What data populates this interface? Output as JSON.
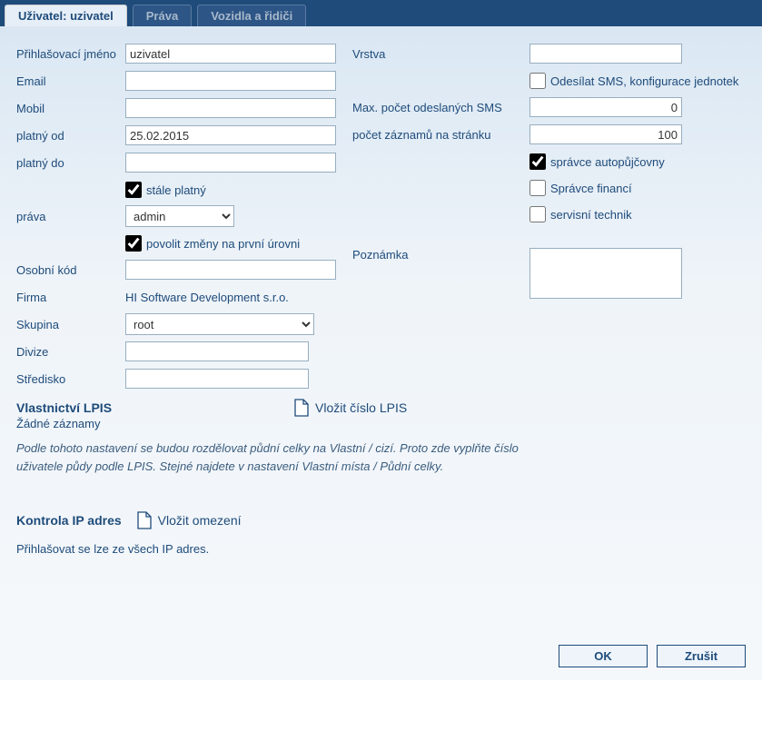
{
  "tabs": {
    "user": "Uživatel:  uzivatel",
    "rights": "Práva",
    "vehicles": "Vozidla a řidiči"
  },
  "left": {
    "login_label": "Přihlašovací jméno",
    "login_value": "uzivatel",
    "email_label": "Email",
    "email_value": "",
    "mobile_label": "Mobil",
    "mobile_value": "",
    "valid_from_label": "platný od",
    "valid_from_value": "25.02.2015",
    "valid_to_label": "platný do",
    "valid_to_value": "",
    "always_valid_label": "stále platný",
    "rights_label": "práva",
    "rights_value": "admin",
    "allow_changes_label": "povolit změny na první úrovni",
    "personal_code_label": "Osobní kód",
    "personal_code_value": "",
    "company_label": "Firma",
    "company_value": "HI Software Development s.r.o.",
    "group_label": "Skupina",
    "group_value": "root",
    "division_label": "Divize",
    "division_value": "",
    "center_label": "Středisko",
    "center_value": ""
  },
  "right": {
    "layer_label": "Vrstva",
    "layer_value": "",
    "send_sms_label": "Odesílat SMS, konfigurace jednotek",
    "max_sms_label": "Max. počet odeslaných SMS",
    "max_sms_value": "0",
    "records_label": "počet záznamů na stránku",
    "records_value": "100",
    "rental_admin_label": "správce autopůjčovny",
    "finance_admin_label": "Správce financí",
    "service_tech_label": "servisní technik",
    "note_label": "Poznámka",
    "note_value": ""
  },
  "lpis": {
    "title": "Vlastnictví LPIS",
    "insert_link": "Vložit číslo LPIS",
    "no_records": "Žádné záznamy",
    "description": "Podle tohoto nastavení se budou rozdělovat půdní celky na Vlastní / cizí. Proto zde vyplňte číslo uživatele půdy podle LPIS. Stejné najdete v nastavení Vlastní místa / Půdní celky."
  },
  "ip": {
    "title": "Kontrola IP adres",
    "insert_link": "Vložit omezení",
    "description": "Přihlašovat se lze ze všech IP adres."
  },
  "buttons": {
    "ok": "OK",
    "cancel": "Zrušit"
  }
}
